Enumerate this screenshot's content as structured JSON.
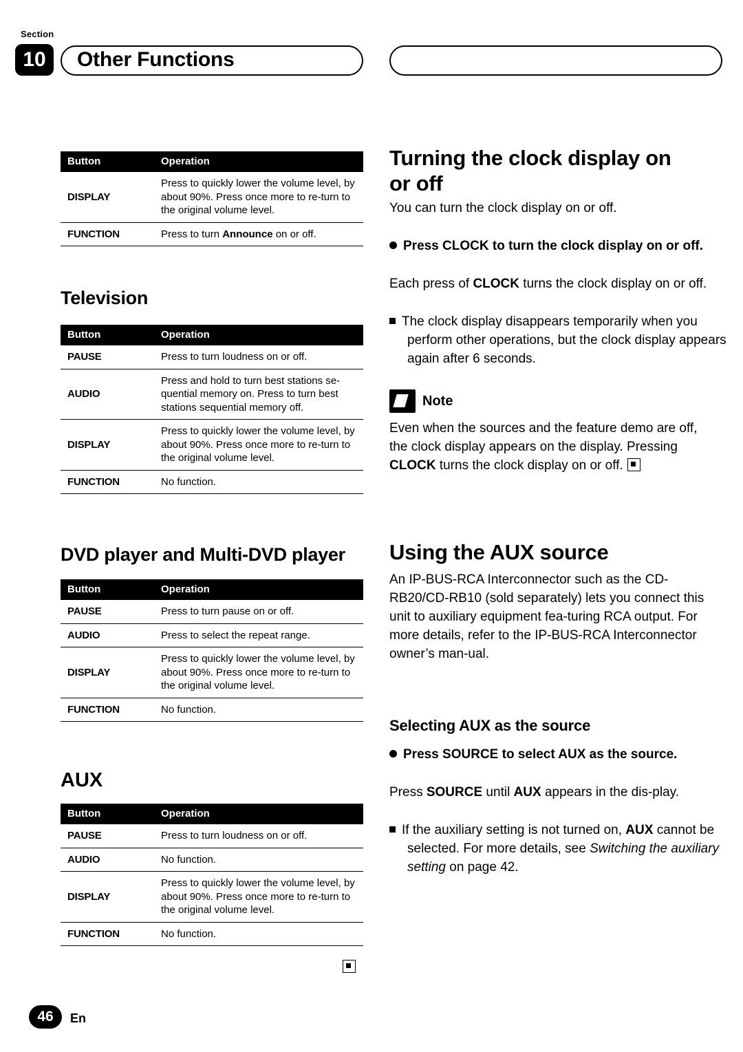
{
  "header": {
    "section_word": "Section",
    "section_number": "10",
    "title": "Other Functions"
  },
  "footer": {
    "page_number": "46",
    "language": "En"
  },
  "table_headers": {
    "button": "Button",
    "operation": "Operation"
  },
  "left_column": {
    "table_top": {
      "rows": [
        {
          "button": "DISPLAY",
          "operation": "Press to quickly lower the volume level, by about 90%. Press once more to re-turn to the original volume level."
        },
        {
          "button": "FUNCTION",
          "operation_pre": "Press to turn ",
          "operation_bold": "Announce",
          "operation_post": " on or off."
        }
      ]
    },
    "television": {
      "heading": "Television",
      "rows": [
        {
          "button": "PAUSE",
          "operation": "Press to turn loudness on or off."
        },
        {
          "button": "AUDIO",
          "operation": "Press and hold to turn best stations se-quential memory on. Press to turn best stations sequential memory off."
        },
        {
          "button": "DISPLAY",
          "operation": "Press to quickly lower the volume level, by about 90%. Press once more to re-turn to the original volume level."
        },
        {
          "button": "FUNCTION",
          "operation": "No function."
        }
      ]
    },
    "dvd": {
      "heading": "DVD player and Multi-DVD player",
      "rows": [
        {
          "button": "PAUSE",
          "operation": "Press to turn pause on or off."
        },
        {
          "button": "AUDIO",
          "operation": "Press to select the repeat range."
        },
        {
          "button": "DISPLAY",
          "operation": "Press to quickly lower the volume level, by about 90%. Press once more to re-turn to the original volume level."
        },
        {
          "button": "FUNCTION",
          "operation": "No function."
        }
      ]
    },
    "aux": {
      "heading": "AUX",
      "rows": [
        {
          "button": "PAUSE",
          "operation": "Press to turn loudness on or off."
        },
        {
          "button": "AUDIO",
          "operation": "No function."
        },
        {
          "button": "DISPLAY",
          "operation": "Press to quickly lower the volume level, by about 90%. Press once more to re-turn to the original volume level."
        },
        {
          "button": "FUNCTION",
          "operation": "No function."
        }
      ]
    }
  },
  "right_column": {
    "clock": {
      "heading": "Turning the clock display on or off",
      "intro": "You can turn the clock display on or off.",
      "bullet_heading": "Press CLOCK to turn the clock display on or off.",
      "body_pre": "Each press of ",
      "body_bold": "CLOCK",
      "body_post": " turns the clock display on or off.",
      "note_square": "The clock display disappears temporarily when you perform other operations, but the clock display appears again after 6 seconds.",
      "note_label": "Note",
      "note_body_1": "Even when the sources and the feature demo are off, the clock display appears on the display. Pressing ",
      "note_body_bold": "CLOCK",
      "note_body_2": " turns the clock display on or off."
    },
    "aux_source": {
      "heading": "Using the AUX source",
      "body": "An IP-BUS-RCA Interconnector such as the CD-RB20/CD-RB10 (sold separately) lets you connect this unit to auxiliary equipment fea-turing RCA output. For more details, refer to the IP-BUS-RCA Interconnector owner’s man-ual.",
      "sub_heading": "Selecting AUX as the source",
      "bullet_heading": "Press SOURCE to select AUX as the source.",
      "line_pre": "Press ",
      "line_b1": "SOURCE",
      "line_mid": " until ",
      "line_b2": "AUX",
      "line_post": " appears in the dis-play.",
      "sq_pre": "If the auxiliary setting is not turned on, ",
      "sq_b1": "AUX",
      "sq_mid": " cannot be selected. For more details, see ",
      "sq_italic": "Switching the auxiliary setting",
      "sq_post": " on page 42."
    }
  }
}
